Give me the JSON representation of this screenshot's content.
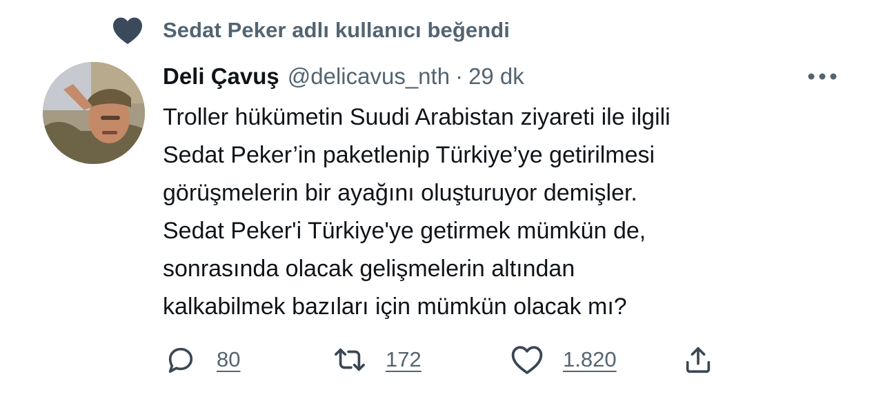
{
  "context": {
    "icon": "heart-icon",
    "text": "Sedat Peker adlı kullanıcı beğendi"
  },
  "tweet": {
    "author_name": "Deli Çavuş",
    "author_handle": "@delicavus_nth",
    "separator": "·",
    "timestamp": "29 dk",
    "more_icon": "more-horizontal-icon",
    "text_lines": [
      "Troller hükümetin Suudi Arabistan ziyareti ile ilgili",
      "Sedat Peker’in paketlenip Türkiye’ye getirilmesi",
      "görüşmelerin bir ayağını oluşturuyor demişler.",
      "Sedat Peker'i Türkiye'ye getirmek mümkün de,",
      "sonrasında olacak gelişmelerin altından",
      "kalkabilmek bazıları için mümkün olacak mı?"
    ],
    "actions": {
      "reply": {
        "icon": "reply-icon",
        "count": "80"
      },
      "retweet": {
        "icon": "retweet-icon",
        "count": "172"
      },
      "like": {
        "icon": "heart-outline-icon",
        "count": "1.820"
      },
      "share": {
        "icon": "share-icon"
      }
    }
  },
  "colors": {
    "text_primary": "#0f1419",
    "text_secondary": "#536471",
    "background": "#ffffff"
  }
}
